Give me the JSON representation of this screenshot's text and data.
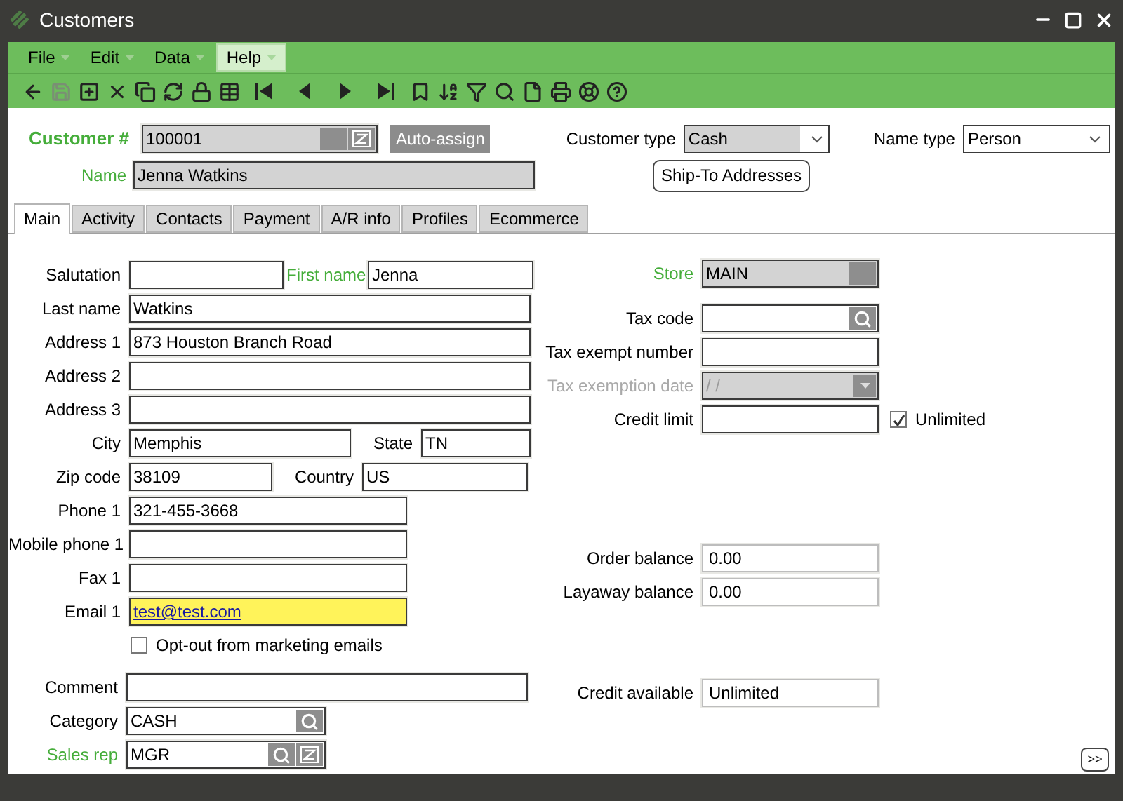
{
  "window": {
    "title": "Customers"
  },
  "menu": [
    {
      "label": "File",
      "selected": false
    },
    {
      "label": "Edit",
      "selected": false
    },
    {
      "label": "Data",
      "selected": false
    },
    {
      "label": "Help",
      "selected": true
    }
  ],
  "header": {
    "customer_number": {
      "label": "Customer #",
      "value": "100001"
    },
    "auto_assign": "Auto-assign",
    "name": {
      "label": "Name",
      "value": "Jenna Watkins"
    },
    "customer_type": {
      "label": "Customer type",
      "value": "Cash"
    },
    "ship_to": "Ship-To Addresses",
    "name_type": {
      "label": "Name type",
      "value": "Person"
    }
  },
  "tabs": [
    {
      "label": "Main",
      "selected": true
    },
    {
      "label": "Activity",
      "selected": false
    },
    {
      "label": "Contacts",
      "selected": false
    },
    {
      "label": "Payment",
      "selected": false
    },
    {
      "label": "A/R info",
      "selected": false
    },
    {
      "label": "Profiles",
      "selected": false
    },
    {
      "label": "Ecommerce",
      "selected": false
    }
  ],
  "main": {
    "salutation": {
      "label": "Salutation",
      "required": false
    },
    "first_name": {
      "label": "First name",
      "value": "Jenna",
      "required": true
    },
    "last_name": {
      "label": "Last name",
      "value": "Watkins",
      "required": false
    },
    "address_1": {
      "label": "Address 1",
      "value": "873 Houston Branch Road",
      "required": false
    },
    "address_2": {
      "label": "Address 2",
      "required": false
    },
    "address_3": {
      "label": "Address 3",
      "required": false
    },
    "city": {
      "label": "City",
      "value": "Memphis",
      "required": false
    },
    "state": {
      "label": "State",
      "value": "TN",
      "required": false
    },
    "zip_code": {
      "label": "Zip code",
      "value": "38109",
      "required": false
    },
    "country": {
      "label": "Country",
      "value": "US",
      "required": false
    },
    "phone_1": {
      "label": "Phone 1",
      "value": "321-455-3668",
      "required": false
    },
    "mobile_phone_1": {
      "label": "Mobile phone 1",
      "required": false
    },
    "fax_1": {
      "label": "Fax 1",
      "required": false
    },
    "email_1": {
      "label": "Email 1",
      "value": "test@test.com",
      "required": false,
      "focused": true
    },
    "opt_out": {
      "label": "Opt-out from marketing emails",
      "checked": false
    },
    "comment": {
      "label": "Comment",
      "required": false
    },
    "category": {
      "label": "Category",
      "value": "CASH",
      "required": false
    },
    "sales_rep": {
      "label": "Sales rep",
      "value": "MGR",
      "required": true
    },
    "store": {
      "label": "Store",
      "value": "MAIN",
      "required": true
    },
    "tax_code": {
      "label": "Tax code",
      "required": false
    },
    "tax_exempt_number": {
      "label": "Tax exempt number",
      "required": false
    },
    "tax_exemption_date": {
      "label": "Tax exemption date",
      "value": "/ /",
      "disabled": true
    },
    "credit_limit": {
      "label": "Credit limit",
      "required": false
    },
    "unlimited": {
      "label": "Unlimited",
      "checked": true
    },
    "order_balance": {
      "label": "Order balance",
      "value": "0.00",
      "required": false
    },
    "layaway_balance": {
      "label": "Layaway balance",
      "value": "0.00",
      "required": false
    },
    "credit_available": {
      "label": "Credit available",
      "value": "Unlimited",
      "required": false
    }
  },
  "more_button": ">>"
}
